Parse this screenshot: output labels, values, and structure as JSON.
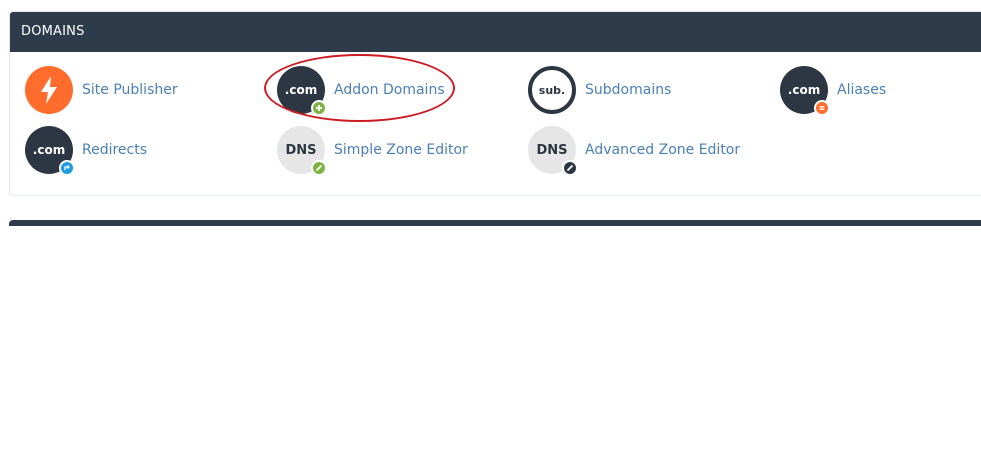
{
  "section": {
    "title": "DOMAINS"
  },
  "items": [
    {
      "label": "Site Publisher",
      "icon": "lightning-bolt-icon",
      "icon_text": ""
    },
    {
      "label": "Addon Domains",
      "icon": "dotcom-plus-icon",
      "icon_text": ".com"
    },
    {
      "label": "Subdomains",
      "icon": "sub-icon",
      "icon_text": "sub."
    },
    {
      "label": "Aliases",
      "icon": "dotcom-equals-icon",
      "icon_text": ".com"
    },
    {
      "label": "Redirects",
      "icon": "dotcom-redirect-icon",
      "icon_text": ".com"
    },
    {
      "label": "Simple Zone Editor",
      "icon": "dns-pencil-icon",
      "icon_text": "DNS"
    },
    {
      "label": "Advanced Zone Editor",
      "icon": "dns-pencil-dark-icon",
      "icon_text": "DNS"
    }
  ],
  "colors": {
    "header_bg": "#2e3b4a",
    "link": "#4a7fb4",
    "orange": "#ff6c2c",
    "green_badge": "#7cb342",
    "blue_badge": "#1e9ae0",
    "dark_icon": "#2d3743",
    "annotation_circle": "#cc1b22"
  }
}
